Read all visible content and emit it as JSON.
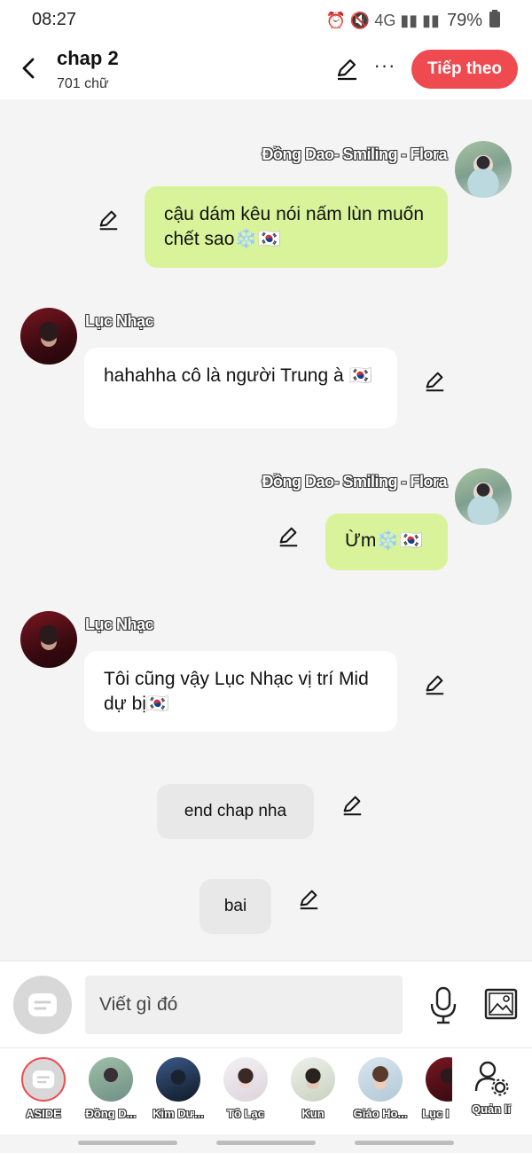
{
  "status_bar": {
    "time": "08:27",
    "icons": "⏰ 🔇 4G ▮▮ ▮▮",
    "battery": "79%"
  },
  "header": {
    "title": "chap 2",
    "subtitle": "701 chữ",
    "next_label": "Tiếp theo"
  },
  "messages": [
    {
      "sender": "Đồng Dao- Smiling - Flora",
      "text": "cậu dám kêu nói nấm lùn muốn chết sao❄️🇰🇷"
    },
    {
      "sender": "Lục Nhạc",
      "text": "hahahha cô là người Trung à 🇰🇷"
    },
    {
      "sender": "Đồng Dao- Smiling - Flora",
      "text": "Ừm❄️🇰🇷"
    },
    {
      "sender": "Lục Nhạc",
      "text": "Tôi cũng vậy Lục Nhạc vị trí Mid dự bị🇰🇷"
    },
    {
      "sender": "",
      "text": "end chap nha"
    },
    {
      "sender": "",
      "text": "bai"
    }
  ],
  "input": {
    "placeholder": "Viết gì đó"
  },
  "characters": [
    {
      "label": "ASIDE"
    },
    {
      "label": "Đồng D..."
    },
    {
      "label": "Kim Dư..."
    },
    {
      "label": "Tô Lạc"
    },
    {
      "label": "Kun"
    },
    {
      "label": "Giáo Ho..."
    },
    {
      "label": "Lục I"
    }
  ],
  "manage_label": "Quản lí",
  "colors": {
    "accent": "#ef4a4f",
    "bubble_green": "#d9f39a",
    "bubble_white": "#ffffff",
    "bubble_grey": "#e8e8e8"
  },
  "icons": [
    "back-arrow-icon",
    "pencil-icon",
    "more-icon",
    "chat-icon",
    "microphone-icon",
    "image-icon",
    "user-gear-icon"
  ]
}
